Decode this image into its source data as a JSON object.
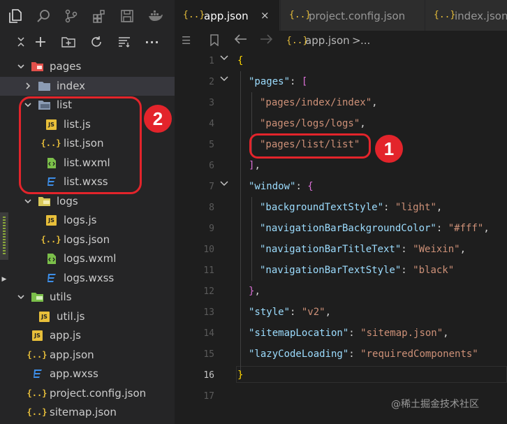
{
  "activity_bar": {
    "icons": [
      "files-icon",
      "search-icon",
      "source-control-icon",
      "extensions-icon",
      "save-icon",
      "docker-icon"
    ]
  },
  "toolbar": {
    "icons": [
      "collapse-icon",
      "new-file-icon",
      "new-folder-icon",
      "refresh-icon",
      "sort-icon",
      "more-icon"
    ],
    "more_label": "···"
  },
  "tree": [
    {
      "label": "pages",
      "type": "folder-open",
      "color": "#e2504b"
    },
    {
      "label": "index",
      "type": "folder-closed",
      "color": "#8b9bb4"
    },
    {
      "label": "list",
      "type": "folder-open",
      "color": "#8b9bb4"
    },
    {
      "label": "list.js",
      "type": "js"
    },
    {
      "label": "list.json",
      "type": "json"
    },
    {
      "label": "list.wxml",
      "type": "wxml"
    },
    {
      "label": "list.wxss",
      "type": "wxss"
    },
    {
      "label": "logs",
      "type": "folder-open",
      "color": "#d9c95a"
    },
    {
      "label": "logs.js",
      "type": "js"
    },
    {
      "label": "logs.json",
      "type": "json"
    },
    {
      "label": "logs.wxml",
      "type": "wxml"
    },
    {
      "label": "logs.wxss",
      "type": "wxss"
    },
    {
      "label": "utils",
      "type": "folder-open",
      "color": "#7bbf4a"
    },
    {
      "label": "util.js",
      "type": "js"
    },
    {
      "label": "app.js",
      "type": "js"
    },
    {
      "label": "app.json",
      "type": "json"
    },
    {
      "label": "app.wxss",
      "type": "wxss"
    },
    {
      "label": "project.config.json",
      "type": "json"
    },
    {
      "label": "sitemap.json",
      "type": "json"
    }
  ],
  "tabs": [
    {
      "icon": "{..}",
      "label": "app.json",
      "close": "×",
      "active": true
    },
    {
      "icon": "{..}",
      "label": "project.config.json",
      "active": false
    },
    {
      "icon": "{..}",
      "label": "index.json",
      "active": false
    }
  ],
  "breadcrumb": {
    "icon": "{..}",
    "file": "app.json",
    "separator": ">",
    "rest": "..."
  },
  "line_numbers": [
    "1",
    "2",
    "3",
    "4",
    "5",
    "6",
    "7",
    "8",
    "9",
    "10",
    "11",
    "12",
    "13",
    "14",
    "15",
    "16",
    "17"
  ],
  "code": {
    "l1": "{",
    "l2_key": "\"pages\"",
    "l2_colon": ": ",
    "l2_br": "[",
    "l3": "\"pages/index/index\"",
    "comma": ",",
    "l4": "\"pages/logs/logs\"",
    "l5": "\"pages/list/list\"",
    "l6_br": "]",
    "l7_key": "\"window\"",
    "l7_br": "{",
    "l8_key": "\"backgroundTextStyle\"",
    "l8_val": "\"light\"",
    "l9_key": "\"navigationBarBackgroundColor\"",
    "l9_val": "\"#fff\"",
    "l10_key": "\"navigationBarTitleText\"",
    "l10_val": "\"Weixin\"",
    "l11_key": "\"navigationBarTextStyle\"",
    "l11_val": "\"black\"",
    "l12_br": "}",
    "l13_key": "\"style\"",
    "l13_val": "\"v2\"",
    "l14_key": "\"sitemapLocation\"",
    "l14_val": "\"sitemap.json\"",
    "l15_key": "\"lazyCodeLoading\"",
    "l15_val": "\"requiredComponents\"",
    "l16": "}"
  },
  "annotations": {
    "marker_1": "1",
    "marker_2": "2"
  },
  "watermark": "@稀土掘金技术社区",
  "colors": {
    "accent": "#e3242b",
    "json_icon": "#e8bf3a",
    "css_icon": "#3d8ee8",
    "wxml_icon": "#7bbf4a"
  }
}
